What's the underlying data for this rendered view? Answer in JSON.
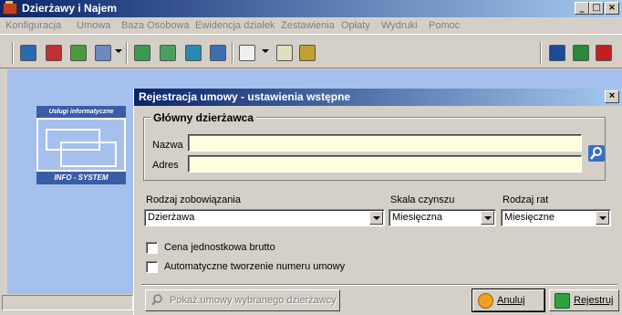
{
  "window": {
    "title": "Dzierżawy i Najem",
    "minimize": "_",
    "maximize": "□",
    "close": "×"
  },
  "menu": [
    "Konfiguracja",
    "Umowa",
    "Baza Osobowa",
    "Ewidencja działek",
    "Zestawienia",
    "Opłaty",
    "Wydruki",
    "Pomoc"
  ],
  "logo": {
    "top": "Usługi informatyczne",
    "bottom": "INFO - SYSTEM"
  },
  "dialog": {
    "title": "Rejestracja umowy - ustawienia wstępne",
    "close": "×",
    "group_title": "Główny dzierżawca",
    "nazwa_label": "Nazwa",
    "adres_label": "Adres",
    "nazwa_value": "",
    "adres_value": "",
    "rodzaj_zob_label": "Rodzaj zobowiązania",
    "rodzaj_zob_value": "Dzierżawa",
    "skala_label": "Skala czynszu",
    "skala_value": "Miesięczna",
    "rodzaj_rat_label": "Rodzaj rat",
    "rodzaj_rat_value": "Miesięczne",
    "check_cena": "Cena jednostkowa brutto",
    "check_auto": "Automatyczne tworzenie numeru umowy",
    "btn_pokaz": "Pokaż umowy wybranego dzierżawcy",
    "btn_anuluj": "Anuluj",
    "btn_rejestruj": "Rejestruj"
  },
  "colors": {
    "title_start": "#0a246a",
    "title_end": "#a6caf0",
    "workspace": "#a6c0ee",
    "field": "#ffffe0"
  }
}
